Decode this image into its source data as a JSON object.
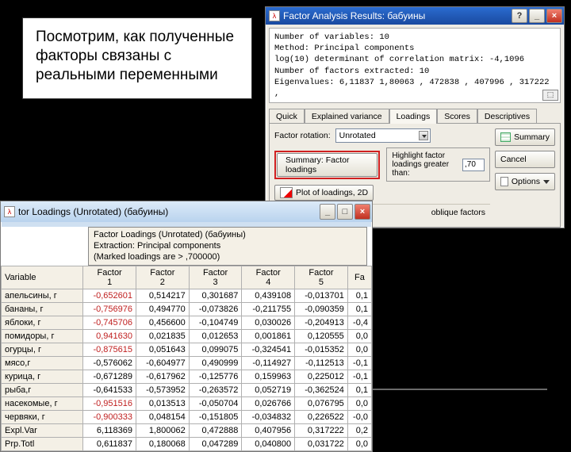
{
  "note_text": "Посмотрим, как полученные факторы связаны с реальными переменными",
  "results_win": {
    "title": "Factor Analysis Results: бабуины",
    "info": {
      "l1": "Number of variables: 10",
      "l2": "Method: Principal components",
      "l3": "log(10) determinant of correlation matrix: -4,1096",
      "l4": "Number of factors extracted: 10",
      "l5": "Eigenvalues: 6,11837 1,80063 , 472838 , 407996 , 317222 ,"
    },
    "tabs": [
      "Quick",
      "Explained variance",
      "Loadings",
      "Scores",
      "Descriptives"
    ],
    "summary_btn": "Summary",
    "cancel_btn": "Cancel",
    "options_btn": "Options",
    "rotation_label": "Factor rotation:",
    "rotation_value": "Unrotated",
    "highlight_label1": "Highlight factor",
    "highlight_label2": "loadings greater than:",
    "highlight_value": ",70",
    "sum_load_btn": "Summary: Factor loadings",
    "plot2d_btn": "Plot of loadings, 2D",
    "oblique_label": "oblique factors"
  },
  "loadings_win": {
    "title": "tor Loadings (Unrotated) (бабуины)",
    "header_l1": "Factor Loadings (Unrotated) (бабуины)",
    "header_l2": "Extraction: Principal components",
    "header_l3": "(Marked loadings are > ,700000)",
    "var_head": "Variable",
    "factor_heads": [
      "Factor\n1",
      "Factor\n2",
      "Factor\n3",
      "Factor\n4",
      "Factor\n5",
      "Fa\n"
    ],
    "rows": [
      {
        "n": "апельсины, г",
        "v": [
          "-0,652601",
          "0,514217",
          "0,301687",
          "0,439108",
          "-0,013701",
          "0,1"
        ],
        "mark": [
          0
        ]
      },
      {
        "n": "бананы, г",
        "v": [
          "-0,756976",
          "0,494770",
          "-0,073826",
          "-0,211755",
          "-0,090359",
          "0,1"
        ],
        "mark": [
          0
        ]
      },
      {
        "n": "яблоки, г",
        "v": [
          "-0,745706",
          "0,456600",
          "-0,104749",
          "0,030026",
          "-0,204913",
          "-0,4"
        ],
        "mark": [
          0
        ]
      },
      {
        "n": "помидоры, г",
        "v": [
          "0,941630",
          "0,021835",
          "0,012653",
          "0,001861",
          "0,120555",
          "0,0"
        ],
        "mark": [
          0
        ]
      },
      {
        "n": "огурцы, г",
        "v": [
          "-0,875615",
          "0,051643",
          "0,099075",
          "-0,324541",
          "-0,015352",
          "0,0"
        ],
        "mark": [
          0
        ]
      },
      {
        "n": "мясо,г",
        "v": [
          "-0,576062",
          "-0,604977",
          "0,490999",
          "-0,114927",
          "-0,112513",
          "-0,1"
        ],
        "mark": []
      },
      {
        "n": "курица, г",
        "v": [
          "-0,671289",
          "-0,617962",
          "-0,125776",
          "0,159963",
          "0,225012",
          "-0,1"
        ],
        "mark": []
      },
      {
        "n": "рыба,г",
        "v": [
          "-0,641533",
          "-0,573952",
          "-0,263572",
          "0,052719",
          "-0,362524",
          "0,1"
        ],
        "mark": []
      },
      {
        "n": "насекомые, г",
        "v": [
          "-0,951516",
          "0,013513",
          "-0,050704",
          "0,026766",
          "0,076795",
          "0,0"
        ],
        "mark": [
          0
        ]
      },
      {
        "n": "червяки, г",
        "v": [
          "-0,900333",
          "0,048154",
          "-0,151805",
          "-0,034832",
          "0,226522",
          "-0,0"
        ],
        "mark": [
          0
        ]
      },
      {
        "n": "Expl.Var",
        "v": [
          "6,118369",
          "1,800062",
          "0,472888",
          "0,407956",
          "0,317222",
          "0,2"
        ],
        "mark": []
      },
      {
        "n": "Prp.Totl",
        "v": [
          "0,611837",
          "0,180068",
          "0,047289",
          "0,040800",
          "0,031722",
          "0,0"
        ],
        "mark": []
      }
    ]
  }
}
